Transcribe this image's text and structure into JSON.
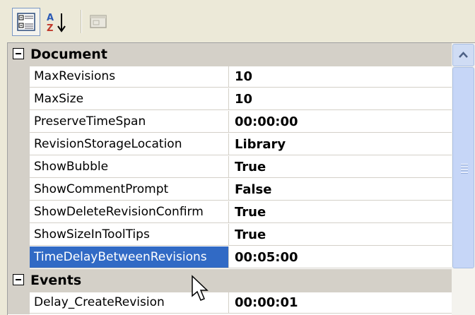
{
  "toolbar": {
    "buttons": [
      {
        "icon": "categorized-view-icon",
        "active": true
      },
      {
        "icon": "alphabetical-sort-icon",
        "active": false
      },
      {
        "icon": "property-pages-icon",
        "active": false,
        "disabled": true
      }
    ]
  },
  "grid": {
    "categories": [
      {
        "name": "Document",
        "expanded": true,
        "properties": [
          {
            "name": "MaxRevisions",
            "value": "10"
          },
          {
            "name": "MaxSize",
            "value": "10"
          },
          {
            "name": "PreserveTimeSpan",
            "value": "00:00:00"
          },
          {
            "name": "RevisionStorageLocation",
            "value": "Library"
          },
          {
            "name": "ShowBubble",
            "value": "True"
          },
          {
            "name": "ShowCommentPrompt",
            "value": "False"
          },
          {
            "name": "ShowDeleteRevisionConfirm",
            "value": "True"
          },
          {
            "name": "ShowSizeInToolTips",
            "value": "True"
          },
          {
            "name": "TimeDelayBetweenRevisions",
            "value": "00:05:00",
            "selected": true
          }
        ]
      },
      {
        "name": "Events",
        "expanded": true,
        "properties": [
          {
            "name": "Delay_CreateRevision",
            "value": "00:00:01"
          }
        ]
      }
    ]
  },
  "colors": {
    "selection": "#316ac5",
    "category_bg": "#d4d0c8",
    "scroll_thumb": "#c6d6f7"
  }
}
